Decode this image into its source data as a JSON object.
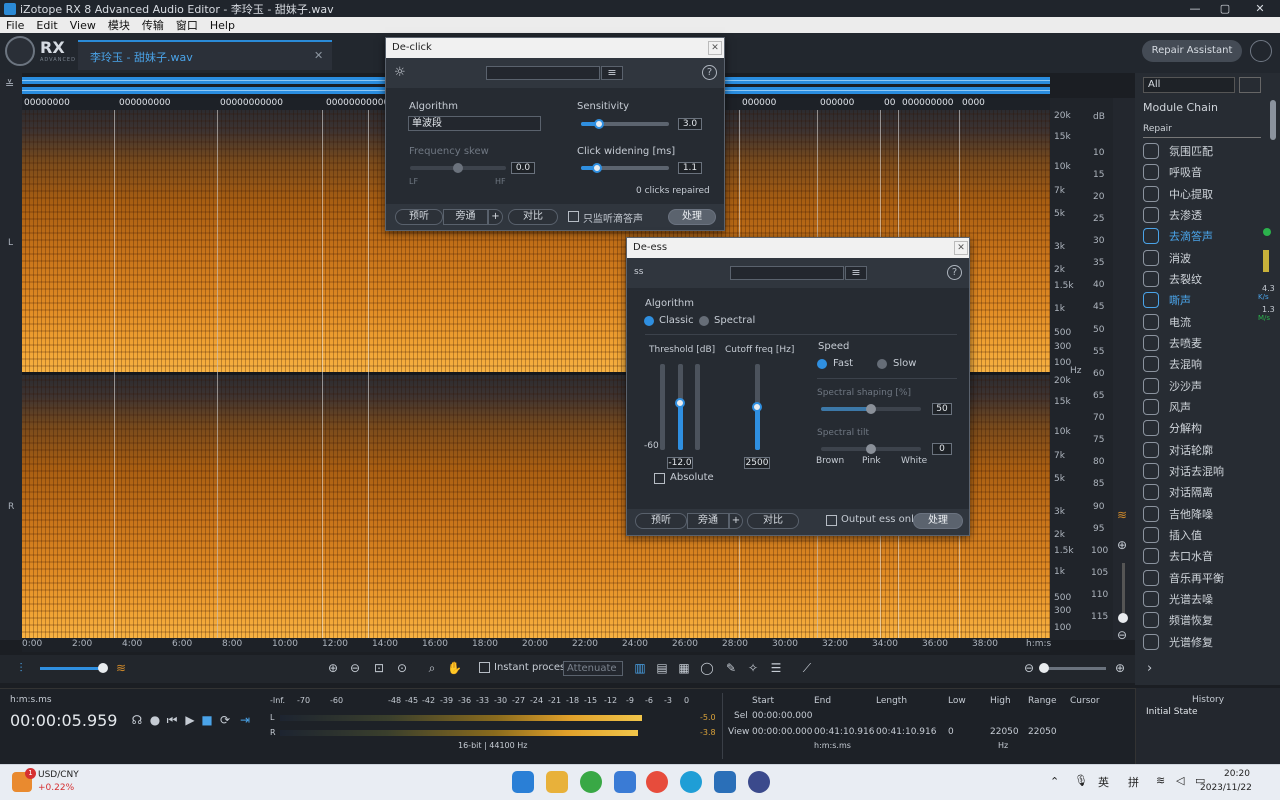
{
  "window": {
    "title": "iZotope RX 8 Advanced Audio Editor - 李玲玉 - 甜妹子.wav",
    "min": "—",
    "max": "▢",
    "close": "✕"
  },
  "menu": [
    "File",
    "Edit",
    "View",
    "模块",
    "传输",
    "窗口",
    "Help"
  ],
  "header": {
    "logo_text": "RX",
    "logo_sub": "ADVANCED",
    "file_tab": "李玲玉 - 甜妹子.wav",
    "file_tab_close": "✕",
    "repair_assistant": "Repair Assistant"
  },
  "markers": [
    "00000000",
    "000000000",
    "00000000000",
    "00000000",
    "000",
    "000000",
    "000000",
    "00000000",
    "000000000",
    "0000",
    "0000"
  ],
  "channels": {
    "left": "L",
    "right": "R"
  },
  "freq_labels": [
    "20k",
    "15k",
    "10k",
    "7k",
    "5k",
    "3k",
    "2k",
    "1.5k",
    "1k",
    "500",
    "300",
    "100",
    "Hz",
    "20k",
    "15k",
    "10k",
    "7k",
    "5k",
    "3k",
    "2k",
    "1.5k",
    "1k",
    "500",
    "300",
    "100"
  ],
  "db_labels": [
    "dB",
    "10",
    "15",
    "20",
    "25",
    "30",
    "35",
    "40",
    "45",
    "50",
    "55",
    "60",
    "65",
    "70",
    "75",
    "80",
    "85",
    "90",
    "95",
    "100",
    "105",
    "110",
    "115"
  ],
  "time_labels": [
    "0:00",
    "2:00",
    "4:00",
    "6:00",
    "8:00",
    "10:00",
    "12:00",
    "14:00",
    "16:00",
    "18:00",
    "20:00",
    "22:00",
    "24:00",
    "26:00",
    "28:00",
    "30:00",
    "32:00",
    "34:00",
    "36:00",
    "38:00",
    "h:m:s"
  ],
  "declick": {
    "title": "De-click",
    "close": "✕",
    "algorithm_label": "Algorithm",
    "algorithm_value": "单波段",
    "sensitivity_label": "Sensitivity",
    "sensitivity_value": "3.0",
    "sensitivity": 0.2,
    "freq_skew_label": "Frequency skew",
    "freq_skew_value": "0.0",
    "freq_skew": 0.5,
    "lf": "LF",
    "hf": "HF",
    "click_widening_label": "Click widening [ms]",
    "click_widening_value": "1.1",
    "click_widening": 0.18,
    "status": "0 clicks repaired",
    "preview": "预听",
    "bypass": "旁通",
    "plus": "+",
    "compare": "对比",
    "monitor_clicks": "只监听滴答声",
    "process": "处理"
  },
  "deess": {
    "title": "De-ess",
    "close": "✕",
    "icon_text": "ss",
    "algorithm_label": "Algorithm",
    "classic": "Classic",
    "spectral": "Spectral",
    "threshold_label": "Threshold [dB]",
    "threshold_min": "-60",
    "threshold_value": "-12.0",
    "threshold": 0.55,
    "cutoff_label": "Cutoff freq [Hz]",
    "cutoff_value": "2500",
    "cutoff": 0.5,
    "absolute": "Absolute",
    "speed_label": "Speed",
    "fast": "Fast",
    "slow": "Slow",
    "shaping_label": "Spectral shaping [%]",
    "shaping_value": "50",
    "shaping": 0.5,
    "tilt_label": "Spectral tilt",
    "tilt_value": "0",
    "tilt": 0.5,
    "brown": "Brown",
    "pink": "Pink",
    "white": "White",
    "preview": "预听",
    "bypass": "旁通",
    "plus": "+",
    "compare": "对比",
    "output_only": "Output ess only",
    "process": "处理"
  },
  "right_panel": {
    "filter": "All",
    "module_chain": "Module Chain",
    "category": "Repair",
    "modules": [
      "氛围匹配",
      "呼吸音",
      "中心提取",
      "去渗透",
      "去滴答声",
      "消波",
      "去裂纹",
      "嘶声",
      "电流",
      "去喷麦",
      "去混响",
      "沙沙声",
      "风声",
      "分解构",
      "对话轮廓",
      "对话去混响",
      "对话隔离",
      "吉他降噪",
      "插入值",
      "去口水音",
      "音乐再平衡",
      "光谱去噪",
      "频谱恢复",
      "光谱修复"
    ],
    "active_module": "去滴答声",
    "active_module2": "嘶声"
  },
  "toolbar": {
    "instant_process": "Instant process",
    "attenuate": "Attenuate"
  },
  "transport": {
    "time_format": "h:m:s.ms",
    "time": "00:00:05.959",
    "meter_scale": [
      "-Inf.",
      "-70",
      "-60",
      "-48",
      "-45",
      "-42",
      "-39",
      "-36",
      "-33",
      "-30",
      "-27",
      "-24",
      "-21",
      "-18",
      "-15",
      "-12",
      "-9",
      "-6",
      "-3",
      "0"
    ],
    "left_peak": "-5.0",
    "right_peak": "-3.8",
    "bit_info": "16-bit | 44100 Hz",
    "start_label": "Start",
    "end_label": "End",
    "length_label": "Length",
    "low_label": "Low",
    "high_label": "High",
    "range_label": "Range",
    "cursor_label": "Cursor",
    "sel_label": "Sel",
    "view_label": "View",
    "sel_start": "00:00:00.000",
    "view_start": "00:00:00.000",
    "view_end": "00:41:10.916",
    "view_length": "00:41:10.916",
    "view_low": "0",
    "view_high": "22050",
    "view_range": "22050",
    "time_unit": "h:m:s.ms",
    "hz_unit": "Hz"
  },
  "history": {
    "title": "History",
    "item": "Initial State"
  },
  "meters_right": {
    "a": "4.3",
    "a_unit": "K/s",
    "b": "1.3",
    "b_unit": "M/s"
  },
  "taskbar": {
    "currency": "USD/CNY",
    "change": "+0.22%",
    "badge": "1",
    "ime1": "英",
    "ime2": "拼",
    "time": "20:20",
    "date": "2023/11/22"
  }
}
